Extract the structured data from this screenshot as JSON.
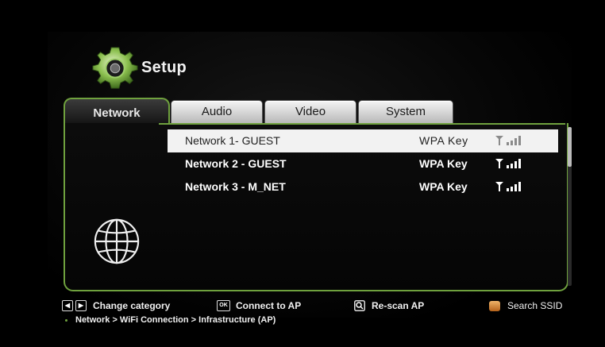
{
  "header": {
    "title": "Setup",
    "icon": "gear-icon"
  },
  "tabs": [
    {
      "label": "Network",
      "active": true
    },
    {
      "label": "Audio",
      "active": false
    },
    {
      "label": "Video",
      "active": false
    },
    {
      "label": "System",
      "active": false
    }
  ],
  "networks": [
    {
      "ssid": "Network 1- GUEST",
      "security": "WPA  Key",
      "selected": true,
      "signal_bars": 4
    },
    {
      "ssid": "Network 2 - GUEST",
      "security": "WPA Key",
      "selected": false,
      "signal_bars": 4
    },
    {
      "ssid": "Network 3 - M_NET",
      "security": "WPA Key",
      "selected": false,
      "signal_bars": 4
    }
  ],
  "footer": {
    "change_category": "Change category",
    "connect": "Connect to AP",
    "ok_key": "OK",
    "rescan": "Re-scan AP",
    "search": "Search SSID",
    "breadcrumb": "Network > WiFi Connection > Infrastructure (AP)"
  },
  "colors": {
    "accent": "#6fa13e",
    "selection": "#f2f2f2",
    "background": "#000000",
    "search_key": "#d2823a"
  }
}
